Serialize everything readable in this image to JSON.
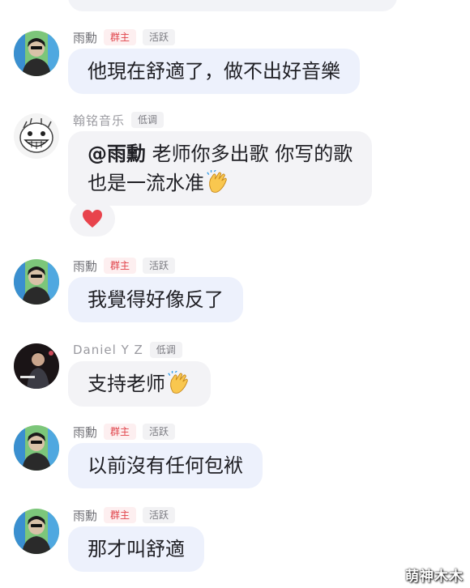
{
  "messages": [
    {
      "sender": "雨勳",
      "tags": [
        "群主",
        "活跃"
      ],
      "text": "他現在舒適了，做不出好音樂"
    },
    {
      "sender": "翰铭音乐",
      "tags": [
        "低调"
      ],
      "mention": "@雨勳",
      "line1": "老师你多出歌 你写的歌",
      "line2": "也是一流水准",
      "emoji": "clapping-hands",
      "reaction": "heart"
    },
    {
      "sender": "雨勳",
      "tags": [
        "群主",
        "活跃"
      ],
      "text": "我覺得好像反了"
    },
    {
      "sender": "Daniel Y Z",
      "tags": [
        "低调"
      ],
      "text": "支持老师",
      "emoji": "clapping-hands"
    },
    {
      "sender": "雨勳",
      "tags": [
        "群主",
        "活跃"
      ],
      "text": "以前沒有任何包袱"
    },
    {
      "sender": "雨勳",
      "tags": [
        "群主",
        "活跃"
      ],
      "text": "那才叫舒適"
    }
  ],
  "watermark": "萌神木木",
  "colors": {
    "owner_tag": "#e0434a",
    "bubble_blue": "#edf1fc",
    "bubble_grey": "#f3f3f6"
  }
}
